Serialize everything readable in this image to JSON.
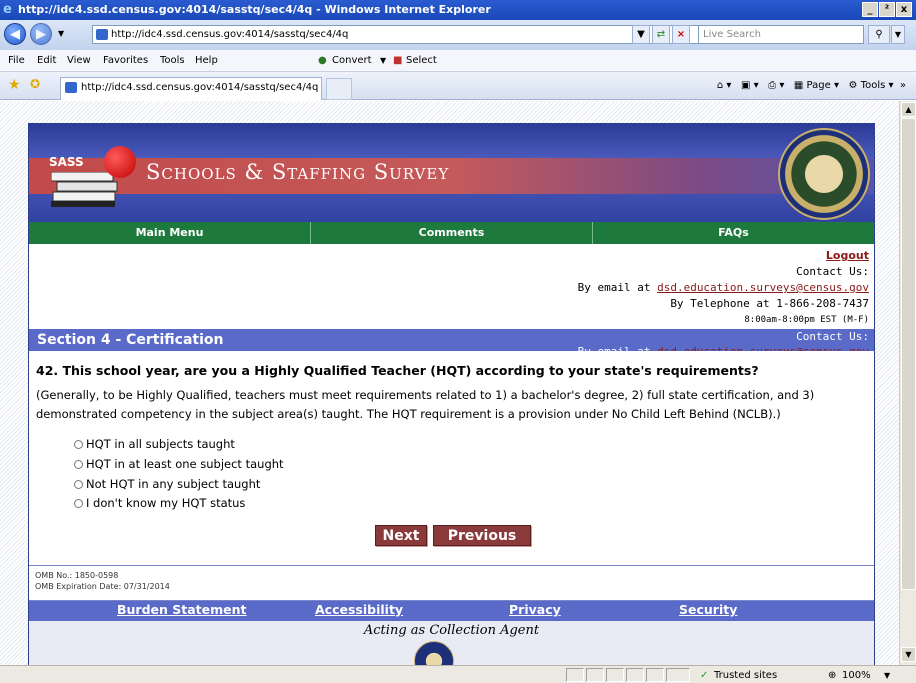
{
  "window": {
    "title": "http://idc4.ssd.census.gov:4014/sasstq/sec4/4q - Windows Internet Explorer",
    "minimize": "_",
    "restore": "²",
    "close": "x"
  },
  "addressbar": {
    "url": "http://idc4.ssd.census.gov:4014/sasstq/sec4/4q",
    "search_placeholder": "Live Search"
  },
  "menu": {
    "items": [
      "File",
      "Edit",
      "View",
      "Favorites",
      "Tools",
      "Help"
    ],
    "convert": "Convert",
    "select": "Select"
  },
  "tab": {
    "label": "http://idc4.ssd.census.gov:4014/sasstq/sec4/4q"
  },
  "commandbar": {
    "page": "Page",
    "tools": "Tools"
  },
  "banner": {
    "sass_label": "SASS",
    "title": "Schools & Staffing Survey"
  },
  "nav": {
    "main_menu": "Main Menu",
    "comments": "Comments",
    "faqs": "FAQs"
  },
  "contact": {
    "logout": "Logout",
    "contact_us": "Contact Us:",
    "email_prefix": "By email at",
    "email": "dsd.education.surveys@census.gov",
    "telephone": "By Telephone at 1-866-208-7437",
    "hours": "8:00am-8:00pm EST (M-F)"
  },
  "section": {
    "title": "Section 4 - Certification"
  },
  "question": {
    "text": "42. This school year, are you a Highly Qualified Teacher (HQT) according to your state's requirements?",
    "explanation": "(Generally, to be Highly Qualified, teachers must meet requirements related to 1) a bachelor's degree, 2) full state certification, and 3) demonstrated competency in the subject area(s) taught. The HQT requirement is a provision under No Child Left Behind (NCLB).)",
    "options": [
      "HQT in all subjects taught",
      "HQT in at least one subject taught",
      "Not HQT in any subject taught",
      "I don't know my HQT status"
    ]
  },
  "buttons": {
    "next": "Next",
    "previous": "Previous"
  },
  "omb": {
    "number": "OMB No.: 1850-0598",
    "expiration": "OMB Expiration Date: 07/31/2014"
  },
  "footer": {
    "burden": "Burden Statement",
    "accessibility": "Accessibility",
    "privacy": "Privacy",
    "security": "Security",
    "collection": "Acting as Collection Agent"
  },
  "status": {
    "zone": "Trusted sites",
    "zoom": "100%"
  }
}
